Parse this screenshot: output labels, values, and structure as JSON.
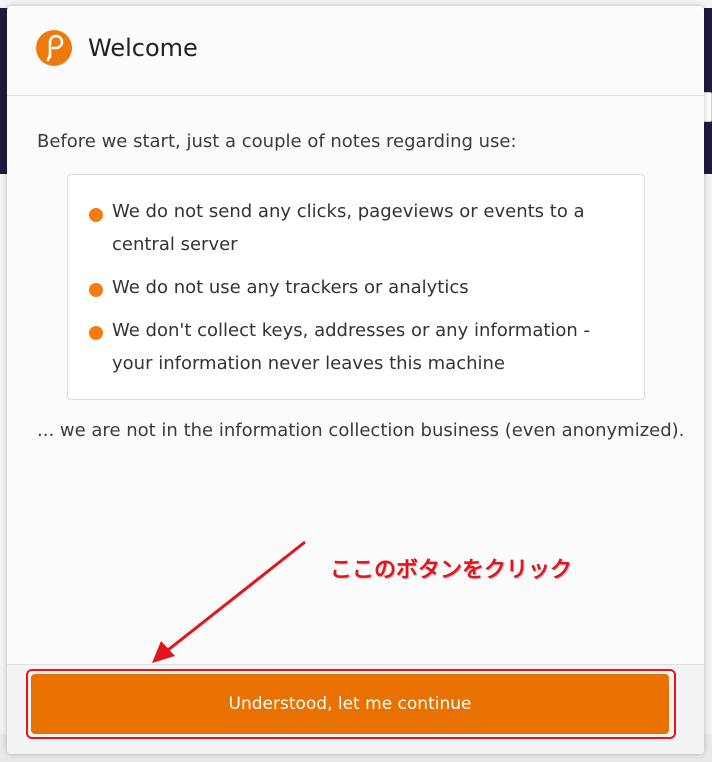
{
  "modal": {
    "title": "Welcome",
    "intro": "Before we start, just a couple of notes regarding use:",
    "notes": [
      "We do not send any clicks, pageviews or events to a central server",
      "We do not use any trackers or analytics",
      "We don't collect keys, addresses or any information - your information never leaves this machine"
    ],
    "outro": "... we are not in the information collection business (even anonymized).",
    "button_label": "Understood, let me continue",
    "logo_icon": "polkadot-logo-icon",
    "colors": {
      "accent": "#e97100",
      "bullet": "#f47b0c",
      "annotation": "#e3141c"
    }
  },
  "annotation": {
    "text": "ここのボタンをクリック"
  }
}
